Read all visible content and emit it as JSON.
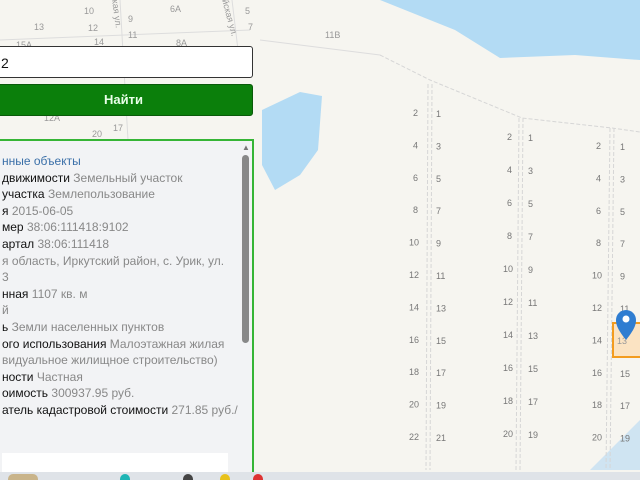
{
  "search": {
    "value": "2"
  },
  "find_button": {
    "label": "Найти"
  },
  "panel": {
    "rows": [
      {
        "label": "",
        "value": "нные объекты",
        "type": "link"
      },
      {
        "label": "движимости",
        "value": "Земельный участок"
      },
      {
        "label": "участка",
        "value": "Землепользование"
      },
      {
        "label": "я",
        "value": "2015-06-05"
      },
      {
        "label": "мер",
        "value": "38:06:111418:9102"
      },
      {
        "label": "артал",
        "value": "38:06:111418"
      },
      {
        "label": "",
        "value": "я область, Иркутский район, с. Урик, ул."
      },
      {
        "label": "",
        "value": "3"
      },
      {
        "label": "нная",
        "value": "1107 кв. м"
      },
      {
        "label": "",
        "value": "й"
      },
      {
        "label": "ь",
        "value": "Земли населенных пунктов"
      },
      {
        "label": "ого использования",
        "value": "Малоэтажная жилая"
      },
      {
        "label": "",
        "value": "видуальное жилищное строительство)"
      },
      {
        "label": "ности",
        "value": "Частная"
      },
      {
        "label": "оимость",
        "value": "300937.95 руб."
      },
      {
        "label": "атель кадастровой стоимости",
        "value": "271.85 руб./"
      }
    ]
  },
  "map": {
    "street_labels": [
      "кая ул.",
      "йская ул."
    ],
    "house_labels": [
      "10",
      "6А",
      "13",
      "12",
      "9",
      "11",
      "8А",
      "11В",
      "14",
      "17",
      "15А",
      "12А",
      "20",
      "5",
      "7"
    ],
    "plot_columns": [
      {
        "even": [
          "2",
          "4",
          "6",
          "8",
          "10",
          "12",
          "14",
          "16",
          "18",
          "20",
          "22"
        ],
        "odd": [
          "1",
          "3",
          "5",
          "7",
          "9",
          "11",
          "13",
          "15",
          "17",
          "19",
          "21"
        ]
      },
      {
        "even": [
          "2",
          "4",
          "6",
          "8",
          "10",
          "12",
          "14",
          "16",
          "18",
          "20"
        ],
        "odd": [
          "1",
          "3",
          "5",
          "7",
          "9",
          "11",
          "13",
          "15",
          "17",
          "19"
        ]
      },
      {
        "even": [
          "2",
          "4",
          "6",
          "8",
          "10",
          "12",
          "14",
          "16",
          "18",
          "20"
        ],
        "odd": [
          "1",
          "3",
          "5",
          "7",
          "9",
          "11",
          "13",
          "15",
          "17",
          "19"
        ]
      }
    ],
    "selected_plot": "13",
    "colors": {
      "water": "#b3dbf4",
      "land": "#f6f5f0",
      "selected": "#f39c1f",
      "marker": "#2f7dd1",
      "accent_green": "#0b7f0b"
    }
  }
}
